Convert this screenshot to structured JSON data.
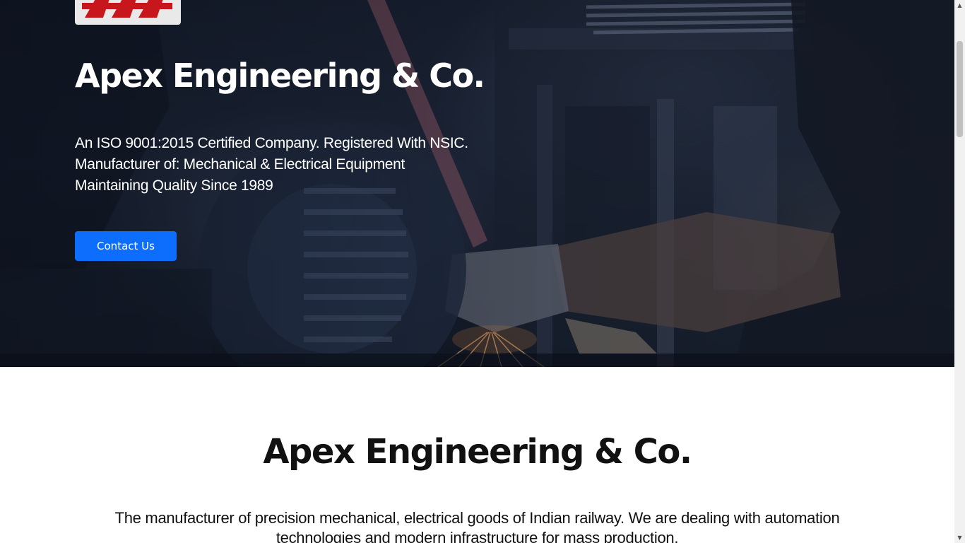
{
  "hero": {
    "logo_name": "apex-logo",
    "title": "Apex Engineering & Co.",
    "lines": [
      "An ISO 9001:2015 Certified Company. Registered With NSIC.",
      "Manufacturer of: Mechanical & Electrical Equipment",
      "Maintaining Quality Since 1989"
    ],
    "cta_label": "Contact Us",
    "cta_color": "#0d6efd",
    "logo_color": "#c8161d"
  },
  "about": {
    "title": "Apex Engineering & Co.",
    "text": "The manufacturer of precision mechanical, electrical goods of Indian railway. We are dealing with automation technologies and modern infrastructure for mass production."
  },
  "scrollbar": {
    "up_icon": "triangle-up-icon",
    "down_icon": "triangle-down-icon"
  }
}
